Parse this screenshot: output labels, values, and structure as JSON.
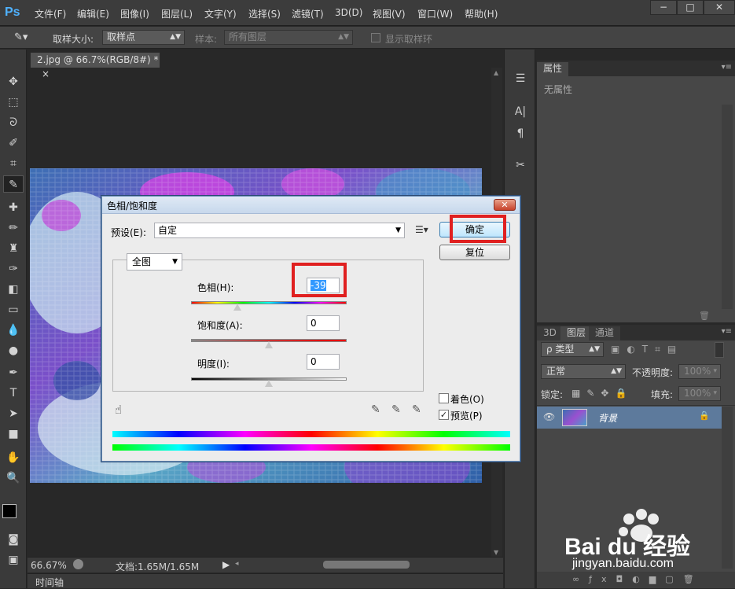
{
  "app": {
    "logo": "Ps"
  },
  "menu": [
    "文件(F)",
    "编辑(E)",
    "图像(I)",
    "图层(L)",
    "文字(Y)",
    "选择(S)",
    "滤镜(T)",
    "3D(D)",
    "视图(V)",
    "窗口(W)",
    "帮助(H)"
  ],
  "window_controls": {
    "minimize": "−",
    "maximize": "□",
    "close": "✕"
  },
  "options": {
    "sample_size_label": "取样大小:",
    "sample_size_value": "取样点",
    "sample_label": "样本:",
    "sample_value": "所有图层",
    "show_ring_label": "显示取样环"
  },
  "document": {
    "tab_title": "2.jpg @ 66.7%(RGB/8#) *",
    "tab_close": "×"
  },
  "status": {
    "zoom": "66.67%",
    "doc_info": "文档:1.65M/1.65M",
    "timeline": "时间轴"
  },
  "properties": {
    "tab": "属性",
    "content": "无属性"
  },
  "layers_panel": {
    "tabs": [
      "3D",
      "图层",
      "通道"
    ],
    "filter_label": "ρ 类型",
    "blend_mode": "正常",
    "opacity_label": "不透明度:",
    "opacity_value": "100%",
    "lock_label": "锁定:",
    "fill_label": "填充:",
    "fill_value": "100%",
    "layer_name": "背景"
  },
  "dialog": {
    "title": "色相/饱和度",
    "preset_label": "预设(E):",
    "preset_value": "自定",
    "ok_button": "确定",
    "reset_button": "复位",
    "channel": "全图",
    "hue_label": "色相(H):",
    "hue_value": "-39",
    "saturation_label": "饱和度(A):",
    "saturation_value": "0",
    "lightness_label": "明度(I):",
    "lightness_value": "0",
    "colorize_label": "着色(O)",
    "colorize_checked": false,
    "preview_label": "预览(P)",
    "preview_checked": true,
    "hue_level": 0.3,
    "saturation_level": 0.5,
    "lightness_level": 0.5
  },
  "watermark": {
    "brand": "Bai du 经验",
    "url": "jingyan.baidu.com"
  },
  "colors": {
    "highlight": "#e02020",
    "ps_blue": "#4fb2ff",
    "dialog_bg": "#ececec",
    "selected_layer": "#5d7a9c"
  }
}
